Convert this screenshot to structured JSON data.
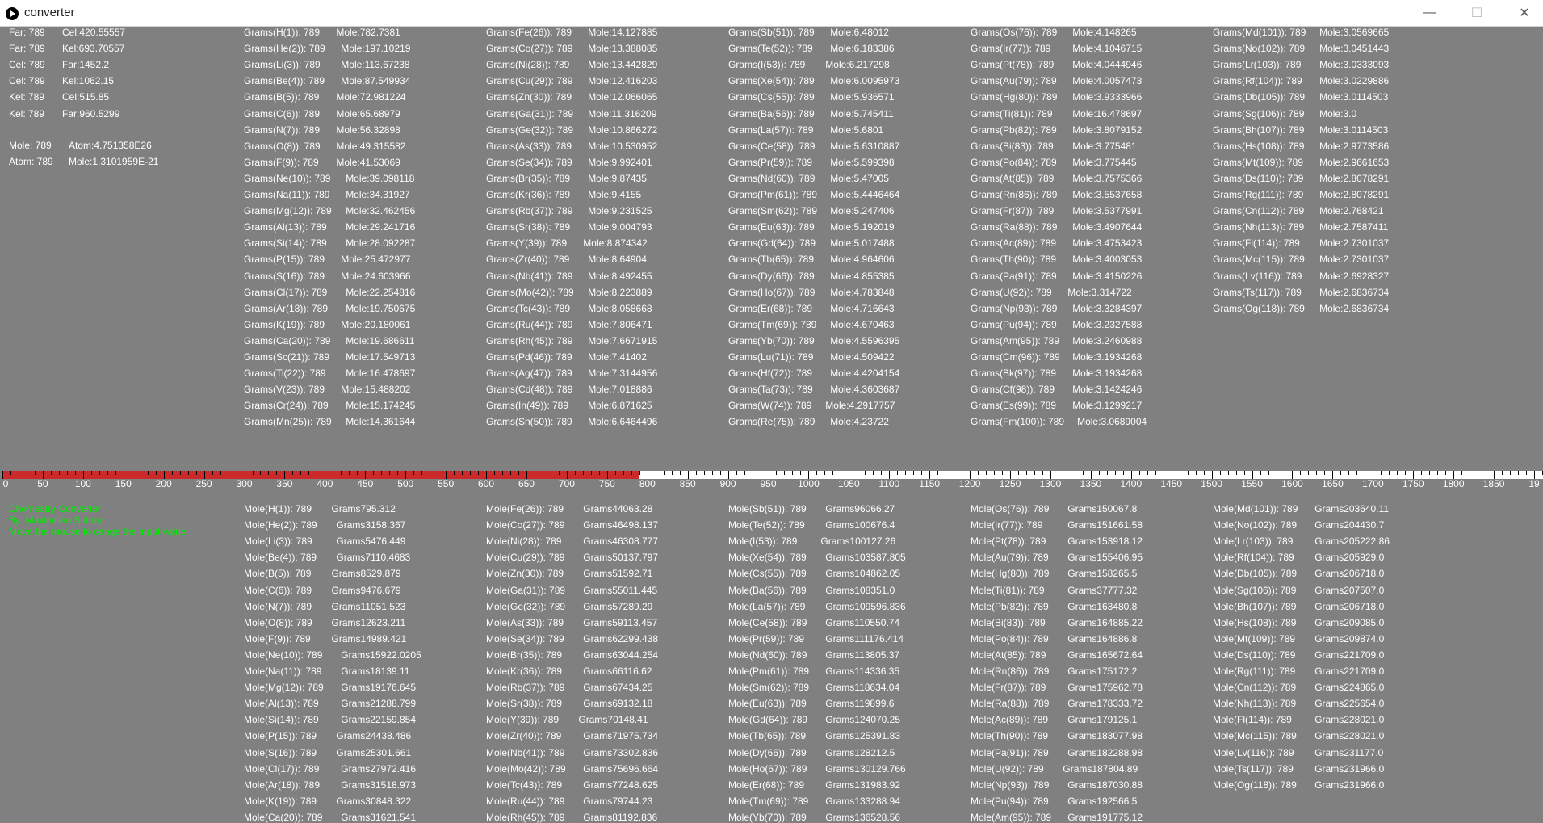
{
  "window": {
    "title": "converter",
    "minimize": "—",
    "maximize": "☐",
    "close": "✕"
  },
  "temperature": [
    [
      "Far: 789",
      "Cel:420.55557"
    ],
    [
      "Far: 789",
      "Kel:693.70557"
    ],
    [
      "Cel: 789",
      "Far:1452.2"
    ],
    [
      "Cel: 789",
      "Kel:1062.15"
    ],
    [
      "Kel: 789",
      "Cel:515.85"
    ],
    [
      "Kel: 789",
      "Far:960.5299"
    ]
  ],
  "atom": [
    [
      "Mole: 789",
      "Atom:4.751358E26"
    ],
    [
      "Atom: 789",
      "Mole:1.3101959E-21"
    ]
  ],
  "credits": [
    "Chemestry Converter",
    "By: Maximilian Sutton",
    "Move the mouse to cange the input value."
  ],
  "slider": {
    "value": 789,
    "min": 0,
    "max": 1911,
    "labels": [
      "0",
      "50",
      "100",
      "150",
      "200",
      "250",
      "300",
      "350",
      "400",
      "450",
      "500",
      "550",
      "600",
      "650",
      "700",
      "750",
      "800",
      "850",
      "900",
      "950",
      "1000",
      "1050",
      "1100",
      "1150",
      "1200",
      "1250",
      "1300",
      "1350",
      "1400",
      "1450",
      "1500",
      "1550",
      "1600",
      "1650",
      "1700",
      "1750",
      "1800",
      "1850",
      "19"
    ]
  },
  "grams_to_mole": [
    [
      [
        "Grams(H(1)): 789",
        "Mole:782.7381"
      ],
      [
        "Grams(He(2)): 789",
        "Mole:197.10219"
      ],
      [
        "Grams(Li(3)): 789",
        "Mole:113.67238"
      ],
      [
        "Grams(Be(4)): 789",
        "Mole:87.549934"
      ],
      [
        "Grams(B(5)): 789",
        "Mole:72.981224"
      ],
      [
        "Grams(C(6)): 789",
        "Mole:65.68979"
      ],
      [
        "Grams(N(7)): 789",
        "Mole:56.32898"
      ],
      [
        "Grams(O(8)): 789",
        "Mole:49.315582"
      ],
      [
        "Grams(F(9)): 789",
        "Mole:41.53069"
      ],
      [
        "Grams(Ne(10)): 789",
        "Mole:39.098118"
      ],
      [
        "Grams(Na(11)): 789",
        "Mole:34.31927"
      ],
      [
        "Grams(Mg(12)): 789",
        "Mole:32.462456"
      ],
      [
        "Grams(Al(13)): 789",
        "Mole:29.241716"
      ],
      [
        "Grams(Si(14)): 789",
        "Mole:28.092287"
      ],
      [
        "Grams(P(15)): 789",
        "Mole:25.472977"
      ],
      [
        "Grams(S(16)): 789",
        "Mole:24.603966"
      ],
      [
        "Grams(Cl(17)): 789",
        "Mole:22.254816"
      ],
      [
        "Grams(Ar(18)): 789",
        "Mole:19.750675"
      ],
      [
        "Grams(K(19)): 789",
        "Mole:20.180061"
      ],
      [
        "Grams(Ca(20)): 789",
        "Mole:19.686611"
      ],
      [
        "Grams(Sc(21)): 789",
        "Mole:17.549713"
      ],
      [
        "Grams(Ti(22)): 789",
        "Mole:16.478697"
      ],
      [
        "Grams(V(23)): 789",
        "Mole:15.488202"
      ],
      [
        "Grams(Cr(24)): 789",
        "Mole:15.174245"
      ],
      [
        "Grams(Mn(25)): 789",
        "Mole:14.361644"
      ]
    ],
    [
      [
        "Grams(Fe(26)): 789",
        "Mole:14.127885"
      ],
      [
        "Grams(Co(27)): 789",
        "Mole:13.388085"
      ],
      [
        "Grams(Ni(28)): 789",
        "Mole:13.442829"
      ],
      [
        "Grams(Cu(29)): 789",
        "Mole:12.416203"
      ],
      [
        "Grams(Zn(30)): 789",
        "Mole:12.066065"
      ],
      [
        "Grams(Ga(31)): 789",
        "Mole:11.316209"
      ],
      [
        "Grams(Ge(32)): 789",
        "Mole:10.866272"
      ],
      [
        "Grams(As(33)): 789",
        "Mole:10.530952"
      ],
      [
        "Grams(Se(34)): 789",
        "Mole:9.992401"
      ],
      [
        "Grams(Br(35)): 789",
        "Mole:9.87435"
      ],
      [
        "Grams(Kr(36)): 789",
        "Mole:9.4155"
      ],
      [
        "Grams(Rb(37)): 789",
        "Mole:9.231525"
      ],
      [
        "Grams(Sr(38)): 789",
        "Mole:9.004793"
      ],
      [
        "Grams(Y(39)): 789",
        "Mole:8.874342"
      ],
      [
        "Grams(Zr(40)): 789",
        "Mole:8.64904"
      ],
      [
        "Grams(Nb(41)): 789",
        "Mole:8.492455"
      ],
      [
        "Grams(Mo(42)): 789",
        "Mole:8.223889"
      ],
      [
        "Grams(Tc(43)): 789",
        "Mole:8.058668"
      ],
      [
        "Grams(Ru(44)): 789",
        "Mole:7.806471"
      ],
      [
        "Grams(Rh(45)): 789",
        "Mole:7.6671915"
      ],
      [
        "Grams(Pd(46)): 789",
        "Mole:7.41402"
      ],
      [
        "Grams(Ag(47)): 789",
        "Mole:7.3144956"
      ],
      [
        "Grams(Cd(48)): 789",
        "Mole:7.018886"
      ],
      [
        "Grams(In(49)): 789",
        "Mole:6.871625"
      ],
      [
        "Grams(Sn(50)): 789",
        "Mole:6.6464496"
      ]
    ],
    [
      [
        "Grams(Sb(51)): 789",
        "Mole:6.48012"
      ],
      [
        "Grams(Te(52)): 789",
        "Mole:6.183386"
      ],
      [
        "Grams(I(53)): 789",
        "Mole:6.217298"
      ],
      [
        "Grams(Xe(54)): 789",
        "Mole:6.0095973"
      ],
      [
        "Grams(Cs(55)): 789",
        "Mole:5.936571"
      ],
      [
        "Grams(Ba(56)): 789",
        "Mole:5.745411"
      ],
      [
        "Grams(La(57)): 789",
        "Mole:5.6801"
      ],
      [
        "Grams(Ce(58)): 789",
        "Mole:5.6310887"
      ],
      [
        "Grams(Pr(59)): 789",
        "Mole:5.599398"
      ],
      [
        "Grams(Nd(60)): 789",
        "Mole:5.47005"
      ],
      [
        "Grams(Pm(61)): 789",
        "Mole:5.4446464"
      ],
      [
        "Grams(Sm(62)): 789",
        "Mole:5.247406"
      ],
      [
        "Grams(Eu(63)): 789",
        "Mole:5.192019"
      ],
      [
        "Grams(Gd(64)): 789",
        "Mole:5.017488"
      ],
      [
        "Grams(Tb(65)): 789",
        "Mole:4.964606"
      ],
      [
        "Grams(Dy(66)): 789",
        "Mole:4.855385"
      ],
      [
        "Grams(Ho(67)): 789",
        "Mole:4.783848"
      ],
      [
        "Grams(Er(68)): 789",
        "Mole:4.716643"
      ],
      [
        "Grams(Tm(69)): 789",
        "Mole:4.670463"
      ],
      [
        "Grams(Yb(70)): 789",
        "Mole:4.5596395"
      ],
      [
        "Grams(Lu(71)): 789",
        "Mole:4.509422"
      ],
      [
        "Grams(Hf(72)): 789",
        "Mole:4.4204154"
      ],
      [
        "Grams(Ta(73)): 789",
        "Mole:4.3603687"
      ],
      [
        "Grams(W(74)): 789",
        "Mole:4.2917757"
      ],
      [
        "Grams(Re(75)): 789",
        "Mole:4.23722"
      ]
    ],
    [
      [
        "Grams(Os(76)): 789",
        "Mole:4.148265"
      ],
      [
        "Grams(Ir(77)): 789",
        "Mole:4.1046715"
      ],
      [
        "Grams(Pt(78)): 789",
        "Mole:4.0444946"
      ],
      [
        "Grams(Au(79)): 789",
        "Mole:4.0057473"
      ],
      [
        "Grams(Hg(80)): 789",
        "Mole:3.9333966"
      ],
      [
        "Grams(Ti(81)): 789",
        "Mole:16.478697"
      ],
      [
        "Grams(Pb(82)): 789",
        "Mole:3.8079152"
      ],
      [
        "Grams(Bi(83)): 789",
        "Mole:3.775481"
      ],
      [
        "Grams(Po(84)): 789",
        "Mole:3.775445"
      ],
      [
        "Grams(At(85)): 789",
        "Mole:3.7575366"
      ],
      [
        "Grams(Rn(86)): 789",
        "Mole:3.5537658"
      ],
      [
        "Grams(Fr(87)): 789",
        "Mole:3.5377991"
      ],
      [
        "Grams(Ra(88)): 789",
        "Mole:3.4907644"
      ],
      [
        "Grams(Ac(89)): 789",
        "Mole:3.4753423"
      ],
      [
        "Grams(Th(90)): 789",
        "Mole:3.4003053"
      ],
      [
        "Grams(Pa(91)): 789",
        "Mole:3.4150226"
      ],
      [
        "Grams(U(92)): 789",
        "Mole:3.314722"
      ],
      [
        "Grams(Np(93)): 789",
        "Mole:3.3284397"
      ],
      [
        "Grams(Pu(94)): 789",
        "Mole:3.2327588"
      ],
      [
        "Grams(Am(95)): 789",
        "Mole:3.2460988"
      ],
      [
        "Grams(Cm(96)): 789",
        "Mole:3.1934268"
      ],
      [
        "Grams(Bk(97)): 789",
        "Mole:3.1934268"
      ],
      [
        "Grams(Cf(98)): 789",
        "Mole:3.1424246"
      ],
      [
        "Grams(Es(99)): 789",
        "Mole:3.1299217"
      ],
      [
        "Grams(Fm(100)): 789",
        "Mole:3.0689004"
      ]
    ],
    [
      [
        "Grams(Md(101)): 789",
        "Mole:3.0569665"
      ],
      [
        "Grams(No(102)): 789",
        "Mole:3.0451443"
      ],
      [
        "Grams(Lr(103)): 789",
        "Mole:3.0333093"
      ],
      [
        "Grams(Rf(104)): 789",
        "Mole:3.0229886"
      ],
      [
        "Grams(Db(105)): 789",
        "Mole:3.0114503"
      ],
      [
        "Grams(Sg(106)): 789",
        "Mole:3.0"
      ],
      [
        "Grams(Bh(107)): 789",
        "Mole:3.0114503"
      ],
      [
        "Grams(Hs(108)): 789",
        "Mole:2.9773586"
      ],
      [
        "Grams(Mt(109)): 789",
        "Mole:2.9661653"
      ],
      [
        "Grams(Ds(110)): 789",
        "Mole:2.8078291"
      ],
      [
        "Grams(Rg(111)): 789",
        "Mole:2.8078291"
      ],
      [
        "Grams(Cn(112)): 789",
        "Mole:2.768421"
      ],
      [
        "Grams(Nh(113)): 789",
        "Mole:2.7587411"
      ],
      [
        "Grams(Fl(114)): 789",
        "Mole:2.7301037"
      ],
      [
        "Grams(Mc(115)): 789",
        "Mole:2.7301037"
      ],
      [
        "Grams(Lv(116)): 789",
        "Mole:2.6928327"
      ],
      [
        "Grams(Ts(117)): 789",
        "Mole:2.6836734"
      ],
      [
        "Grams(Og(118)): 789",
        "Mole:2.6836734"
      ]
    ]
  ],
  "mole_to_grams": [
    [
      [
        "Mole(H(1)): 789",
        "Grams795.312"
      ],
      [
        "Mole(He(2)): 789",
        "Grams3158.367"
      ],
      [
        "Mole(Li(3)): 789",
        "Grams5476.449"
      ],
      [
        "Mole(Be(4)): 789",
        "Grams7110.4683"
      ],
      [
        "Mole(B(5)): 789",
        "Grams8529.879"
      ],
      [
        "Mole(C(6)): 789",
        "Grams9476.679"
      ],
      [
        "Mole(N(7)): 789",
        "Grams11051.523"
      ],
      [
        "Mole(O(8)): 789",
        "Grams12623.211"
      ],
      [
        "Mole(F(9)): 789",
        "Grams14989.421"
      ],
      [
        "Mole(Ne(10)): 789",
        "Grams15922.0205"
      ],
      [
        "Mole(Na(11)): 789",
        "Grams18139.11"
      ],
      [
        "Mole(Mg(12)): 789",
        "Grams19176.645"
      ],
      [
        "Mole(Al(13)): 789",
        "Grams21288.799"
      ],
      [
        "Mole(Si(14)): 789",
        "Grams22159.854"
      ],
      [
        "Mole(P(15)): 789",
        "Grams24438.486"
      ],
      [
        "Mole(S(16)): 789",
        "Grams25301.661"
      ],
      [
        "Mole(Cl(17)): 789",
        "Grams27972.416"
      ],
      [
        "Mole(Ar(18)): 789",
        "Grams31518.973"
      ],
      [
        "Mole(K(19)): 789",
        "Grams30848.322"
      ],
      [
        "Mole(Ca(20)): 789",
        "Grams31621.541"
      ]
    ],
    [
      [
        "Mole(Fe(26)): 789",
        "Grams44063.28"
      ],
      [
        "Mole(Co(27)): 789",
        "Grams46498.137"
      ],
      [
        "Mole(Ni(28)): 789",
        "Grams46308.777"
      ],
      [
        "Mole(Cu(29)): 789",
        "Grams50137.797"
      ],
      [
        "Mole(Zn(30)): 789",
        "Grams51592.71"
      ],
      [
        "Mole(Ga(31)): 789",
        "Grams55011.445"
      ],
      [
        "Mole(Ge(32)): 789",
        "Grams57289.29"
      ],
      [
        "Mole(As(33)): 789",
        "Grams59113.457"
      ],
      [
        "Mole(Se(34)): 789",
        "Grams62299.438"
      ],
      [
        "Mole(Br(35)): 789",
        "Grams63044.254"
      ],
      [
        "Mole(Kr(36)): 789",
        "Grams66116.62"
      ],
      [
        "Mole(Rb(37)): 789",
        "Grams67434.25"
      ],
      [
        "Mole(Sr(38)): 789",
        "Grams69132.18"
      ],
      [
        "Mole(Y(39)): 789",
        "Grams70148.41"
      ],
      [
        "Mole(Zr(40)): 789",
        "Grams71975.734"
      ],
      [
        "Mole(Nb(41)): 789",
        "Grams73302.836"
      ],
      [
        "Mole(Mo(42)): 789",
        "Grams75696.664"
      ],
      [
        "Mole(Tc(43)): 789",
        "Grams77248.625"
      ],
      [
        "Mole(Ru(44)): 789",
        "Grams79744.23"
      ],
      [
        "Mole(Rh(45)): 789",
        "Grams81192.836"
      ]
    ],
    [
      [
        "Mole(Sb(51)): 789",
        "Grams96066.27"
      ],
      [
        "Mole(Te(52)): 789",
        "Grams100676.4"
      ],
      [
        "Mole(I(53)): 789",
        "Grams100127.26"
      ],
      [
        "Mole(Xe(54)): 789",
        "Grams103587.805"
      ],
      [
        "Mole(Cs(55)): 789",
        "Grams104862.05"
      ],
      [
        "Mole(Ba(56)): 789",
        "Grams108351.0"
      ],
      [
        "Mole(La(57)): 789",
        "Grams109596.836"
      ],
      [
        "Mole(Ce(58)): 789",
        "Grams110550.74"
      ],
      [
        "Mole(Pr(59)): 789",
        "Grams111176.414"
      ],
      [
        "Mole(Nd(60)): 789",
        "Grams113805.37"
      ],
      [
        "Mole(Pm(61)): 789",
        "Grams114336.35"
      ],
      [
        "Mole(Sm(62)): 789",
        "Grams118634.04"
      ],
      [
        "Mole(Eu(63)): 789",
        "Grams119899.6"
      ],
      [
        "Mole(Gd(64)): 789",
        "Grams124070.25"
      ],
      [
        "Mole(Tb(65)): 789",
        "Grams125391.83"
      ],
      [
        "Mole(Dy(66)): 789",
        "Grams128212.5"
      ],
      [
        "Mole(Ho(67)): 789",
        "Grams130129.766"
      ],
      [
        "Mole(Er(68)): 789",
        "Grams131983.92"
      ],
      [
        "Mole(Tm(69)): 789",
        "Grams133288.94"
      ],
      [
        "Mole(Yb(70)): 789",
        "Grams136528.56"
      ]
    ],
    [
      [
        "Mole(Os(76)): 789",
        "Grams150067.8"
      ],
      [
        "Mole(Ir(77)): 789",
        "Grams151661.58"
      ],
      [
        "Mole(Pt(78)): 789",
        "Grams153918.12"
      ],
      [
        "Mole(Au(79)): 789",
        "Grams155406.95"
      ],
      [
        "Mole(Hg(80)): 789",
        "Grams158265.5"
      ],
      [
        "Mole(Ti(81)): 789",
        "Grams37777.32"
      ],
      [
        "Mole(Pb(82)): 789",
        "Grams163480.8"
      ],
      [
        "Mole(Bi(83)): 789",
        "Grams164885.22"
      ],
      [
        "Mole(Po(84)): 789",
        "Grams164886.8"
      ],
      [
        "Mole(At(85)): 789",
        "Grams165672.64"
      ],
      [
        "Mole(Rn(86)): 789",
        "Grams175172.2"
      ],
      [
        "Mole(Fr(87)): 789",
        "Grams175962.78"
      ],
      [
        "Mole(Ra(88)): 789",
        "Grams178333.72"
      ],
      [
        "Mole(Ac(89)): 789",
        "Grams179125.1"
      ],
      [
        "Mole(Th(90)): 789",
        "Grams183077.98"
      ],
      [
        "Mole(Pa(91)): 789",
        "Grams182288.98"
      ],
      [
        "Mole(U(92)): 789",
        "Grams187804.89"
      ],
      [
        "Mole(Np(93)): 789",
        "Grams187030.88"
      ],
      [
        "Mole(Pu(94)): 789",
        "Grams192566.5"
      ],
      [
        "Mole(Am(95)): 789",
        "Grams191775.12"
      ]
    ],
    [
      [
        "Mole(Md(101)): 789",
        "Grams203640.11"
      ],
      [
        "Mole(No(102)): 789",
        "Grams204430.7"
      ],
      [
        "Mole(Lr(103)): 789",
        "Grams205222.86"
      ],
      [
        "Mole(Rf(104)): 789",
        "Grams205929.0"
      ],
      [
        "Mole(Db(105)): 789",
        "Grams206718.0"
      ],
      [
        "Mole(Sg(106)): 789",
        "Grams207507.0"
      ],
      [
        "Mole(Bh(107)): 789",
        "Grams206718.0"
      ],
      [
        "Mole(Hs(108)): 789",
        "Grams209085.0"
      ],
      [
        "Mole(Mt(109)): 789",
        "Grams209874.0"
      ],
      [
        "Mole(Ds(110)): 789",
        "Grams221709.0"
      ],
      [
        "Mole(Rg(111)): 789",
        "Grams221709.0"
      ],
      [
        "Mole(Cn(112)): 789",
        "Grams224865.0"
      ],
      [
        "Mole(Nh(113)): 789",
        "Grams225654.0"
      ],
      [
        "Mole(Fl(114)): 789",
        "Grams228021.0"
      ],
      [
        "Mole(Mc(115)): 789",
        "Grams228021.0"
      ],
      [
        "Mole(Lv(116)): 789",
        "Grams231177.0"
      ],
      [
        "Mole(Ts(117)): 789",
        "Grams231966.0"
      ],
      [
        "Mole(Og(118)): 789",
        "Grams231966.0"
      ]
    ]
  ]
}
